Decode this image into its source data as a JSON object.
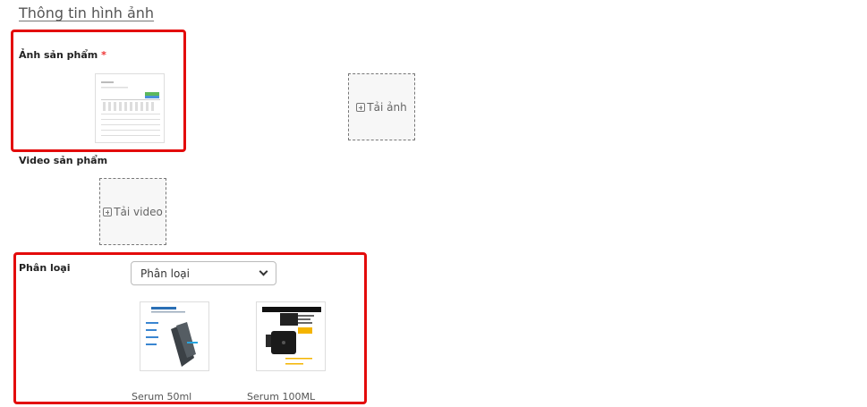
{
  "section": {
    "title": "Thông tin hình ảnh"
  },
  "product_image": {
    "label": "Ảnh sản phẩm",
    "required_mark": "*",
    "upload_label": "Tải ảnh"
  },
  "product_video": {
    "label": "Video sản phẩm",
    "upload_label": "Tải video"
  },
  "variant": {
    "label": "Phân loại",
    "select_value": "Phân loại",
    "items": [
      {
        "name": "Serum 50ml",
        "icon": "product-image-icon"
      },
      {
        "name": "Serum 100ML",
        "icon": "product-image-icon"
      }
    ]
  },
  "colors": {
    "highlight": "#e30b0b",
    "required": "#e33333"
  }
}
